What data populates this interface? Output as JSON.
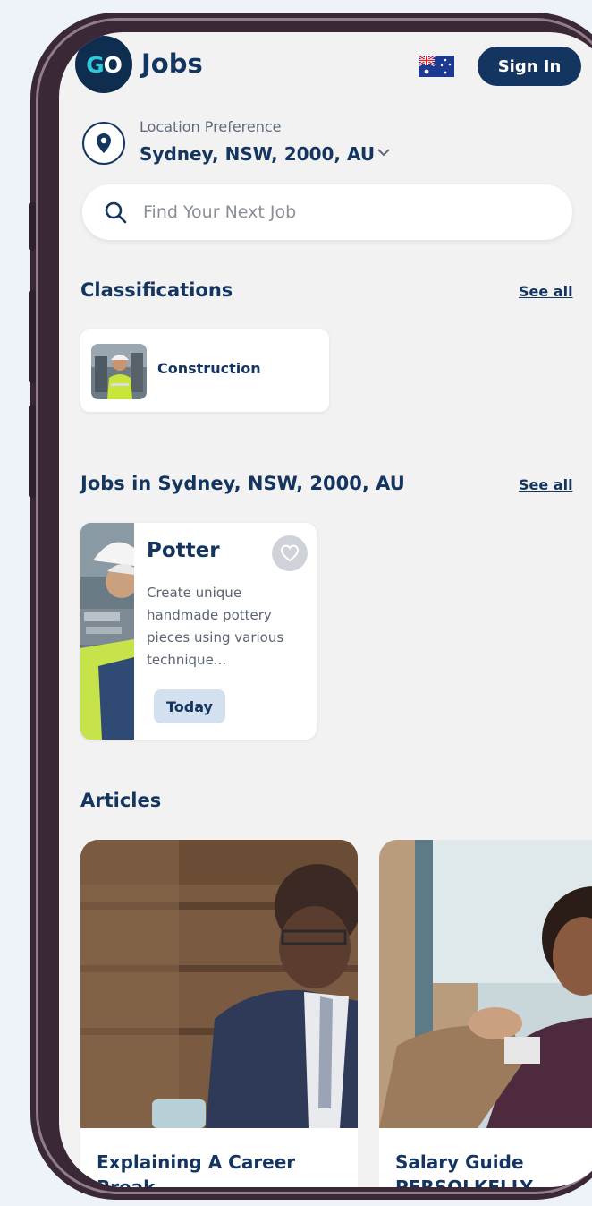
{
  "header": {
    "logo_text_go": "GO",
    "title": "Jobs",
    "flag_icon": "australia-flag-icon",
    "sign_in_label": "Sign In"
  },
  "location": {
    "label": "Location Preference",
    "value": "Sydney, NSW, 2000, AU",
    "icon": "location-pin-icon"
  },
  "search": {
    "placeholder": "Find Your Next Job",
    "value": "",
    "icon": "search-icon"
  },
  "classifications": {
    "title": "Classifications",
    "see_all": "See all",
    "items": [
      {
        "label": "Construction"
      }
    ]
  },
  "jobs": {
    "title": "Jobs in Sydney, NSW, 2000, AU",
    "see_all": "See all",
    "items": [
      {
        "title": "Potter",
        "description": "Create unique handmade pottery pieces using various technique...",
        "badge": "Today"
      }
    ]
  },
  "articles": {
    "title": "Articles",
    "items": [
      {
        "title": "Explaining A Career Break"
      },
      {
        "title": "Salary Guide PERSOLKELLY"
      }
    ]
  },
  "colors": {
    "primary_navy": "#13355f",
    "logo_accent": "#2fc9dc",
    "phone_frame": "#3a2836",
    "screen_bg": "#f2f2f3",
    "badge_bg": "#d3e0ef"
  }
}
